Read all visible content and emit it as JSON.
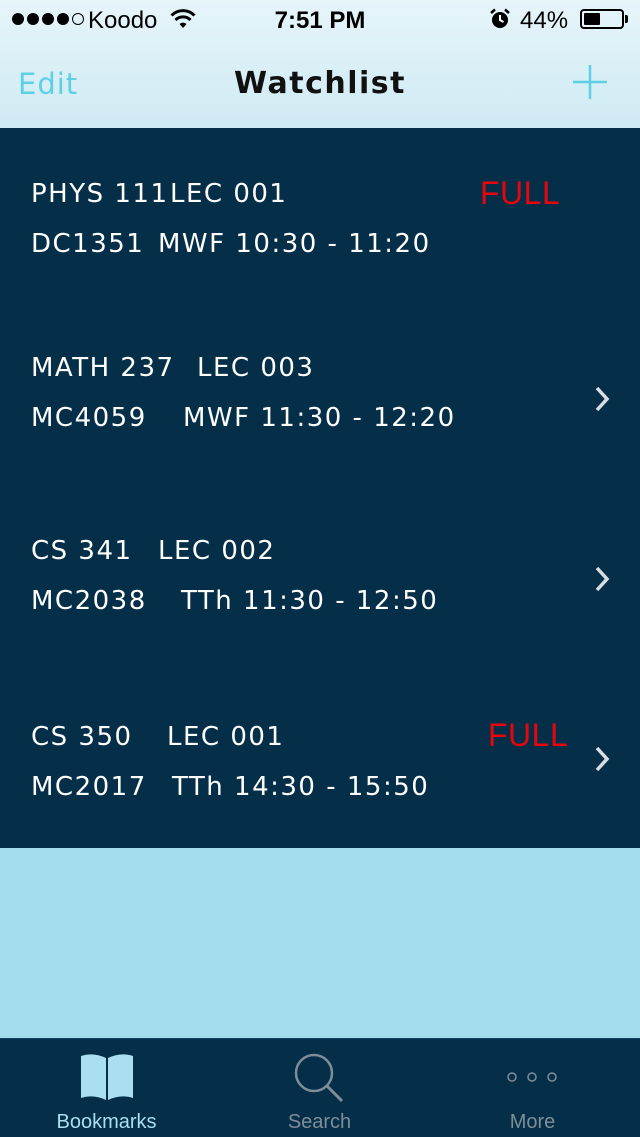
{
  "status_bar": {
    "carrier": "Koodo",
    "time": "7:51 PM",
    "battery_percent": "44%",
    "battery_level": 0.44,
    "signal_bars_filled": 4,
    "signal_bars_total": 5
  },
  "nav": {
    "edit_label": "Edit",
    "title": "Watchlist",
    "add_icon": "plus-icon"
  },
  "colors": {
    "accent": "#5ed0e6",
    "list_background": "#052f48",
    "page_background": "#a3dcec",
    "full_text": "#e8060c"
  },
  "courses": [
    {
      "course": "PHYS 111",
      "section": "LEC 001",
      "room": "DC1351",
      "schedule": "MWF 10:30 - 11:20",
      "full": "FULL",
      "has_chevron": false
    },
    {
      "course": "MATH 237",
      "section": "LEC 003",
      "room": "MC4059",
      "schedule": "MWF 11:30 - 12:20",
      "full": "",
      "has_chevron": true
    },
    {
      "course": "CS 341",
      "section": "LEC 002",
      "room": "MC2038",
      "schedule": "TTh 11:30 - 12:50",
      "full": "",
      "has_chevron": true
    },
    {
      "course": "CS 350",
      "section": "LEC 001",
      "room": "MC2017",
      "schedule": "TTh 14:30 - 15:50",
      "full": "FULL",
      "has_chevron": true
    }
  ],
  "tabs": [
    {
      "label": "Bookmarks",
      "icon": "book-icon",
      "active": true
    },
    {
      "label": "Search",
      "icon": "search-icon",
      "active": false
    },
    {
      "label": "More",
      "icon": "more-icon",
      "active": false
    }
  ]
}
